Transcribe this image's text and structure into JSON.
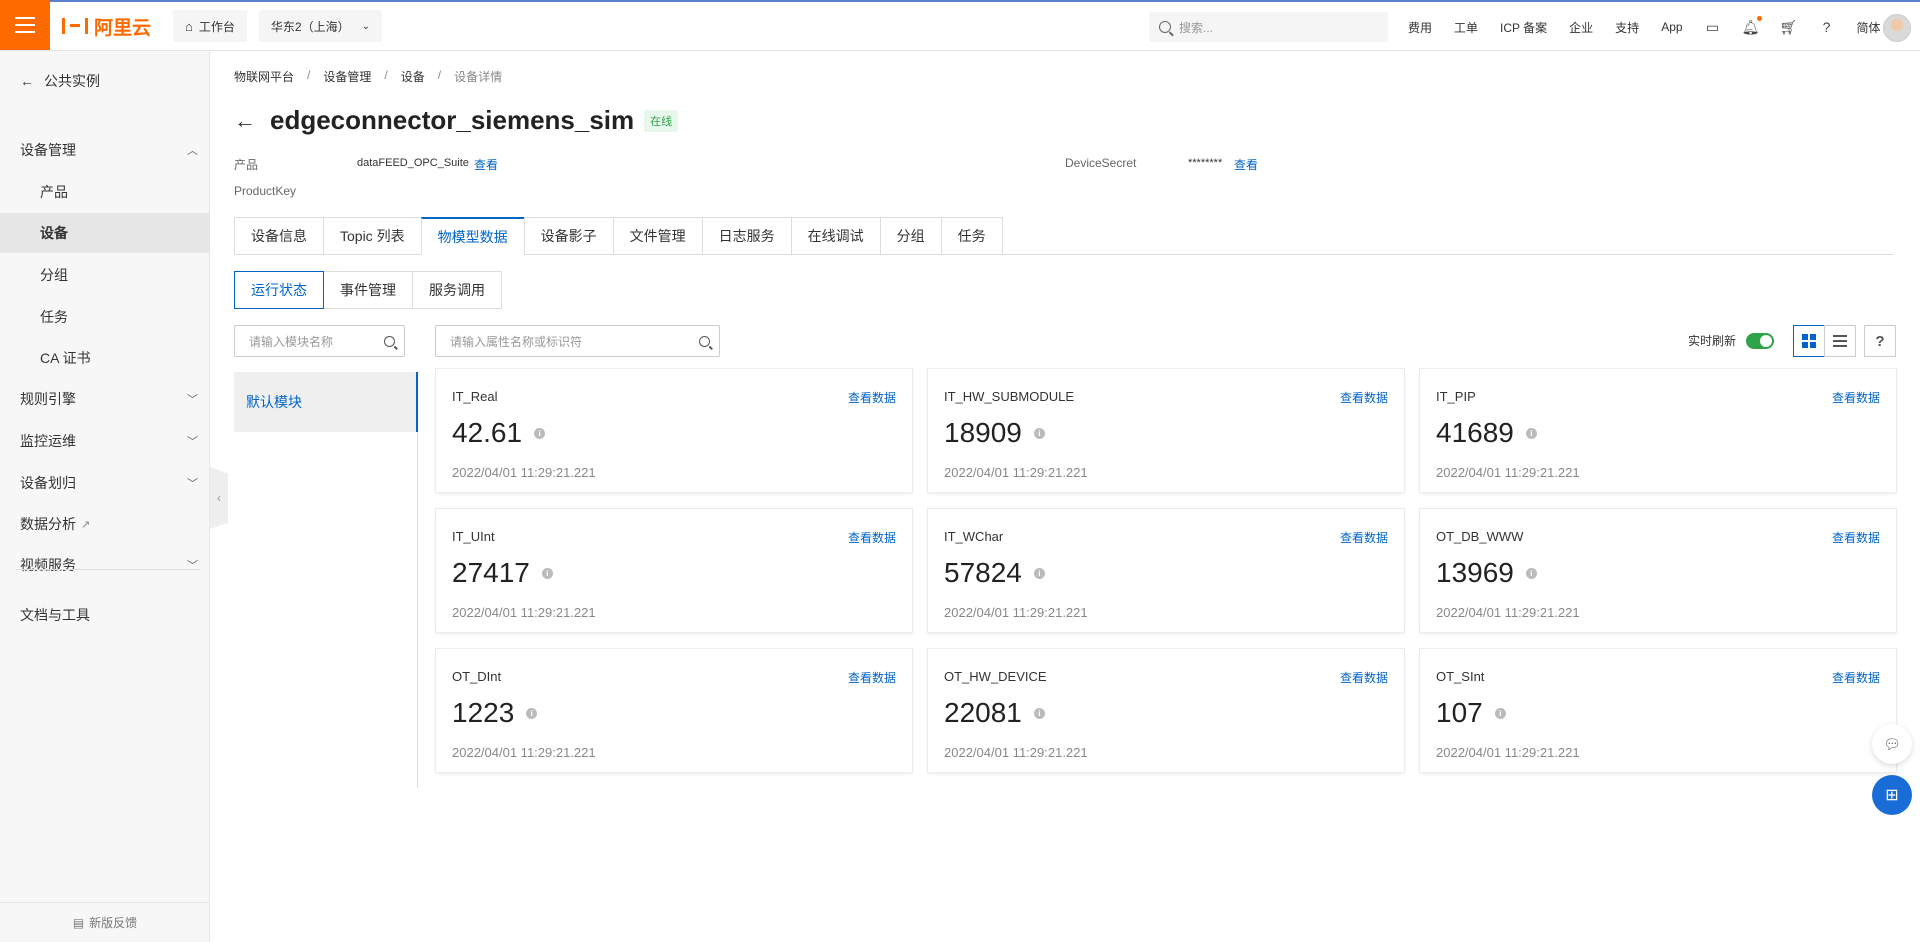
{
  "topbar": {
    "logo_text": "阿里云",
    "workbench": "工作台",
    "region": "华东2（上海）",
    "search_placeholder": "搜索...",
    "links": [
      "费用",
      "工单",
      "ICP 备案",
      "企业",
      "支持",
      "App"
    ],
    "lang": "简体",
    "accent": "#ff6a00"
  },
  "sidebar": {
    "back": "公共实例",
    "group_device": "设备管理",
    "items": [
      "产品",
      "设备",
      "分组",
      "任务",
      "CA 证书"
    ],
    "active_item": "设备",
    "groups": [
      "规则引擎",
      "监控运维",
      "设备划归",
      "数据分析",
      "视频服务"
    ],
    "docs": "文档与工具",
    "feedback": "新版反馈"
  },
  "breadcrumb": [
    "物联网平台",
    "设备管理",
    "设备",
    "设备详情"
  ],
  "device": {
    "name": "edgeconnector_siemens_sim",
    "status": "在线",
    "product_label": "产品",
    "product_value": "dataFEED_OPC_Suite",
    "view": "查看",
    "secret_label": "DeviceSecret",
    "secret_value": "********",
    "productkey_label": "ProductKey"
  },
  "tabs": [
    "设备信息",
    "Topic 列表",
    "物模型数据",
    "设备影子",
    "文件管理",
    "日志服务",
    "在线调试",
    "分组",
    "任务"
  ],
  "active_tab": "物模型数据",
  "subtabs": [
    "运行状态",
    "事件管理",
    "服务调用"
  ],
  "active_subtab": "运行状态",
  "module_search_placeholder": "请输入模块名称",
  "prop_search_placeholder": "请输入属性名称或标识符",
  "module": "默认模块",
  "refresh_label": "实时刷新",
  "card_view_label": "查看数据",
  "cards": [
    {
      "name": "IT_Real",
      "value": "42.61",
      "ts": "2022/04/01 11:29:21.221"
    },
    {
      "name": "IT_HW_SUBMODULE",
      "value": "18909",
      "ts": "2022/04/01 11:29:21.221"
    },
    {
      "name": "IT_PIP",
      "value": "41689",
      "ts": "2022/04/01 11:29:21.221"
    },
    {
      "name": "IT_UInt",
      "value": "27417",
      "ts": "2022/04/01 11:29:21.221"
    },
    {
      "name": "IT_WChar",
      "value": "57824",
      "ts": "2022/04/01 11:29:21.221"
    },
    {
      "name": "OT_DB_WWW",
      "value": "13969",
      "ts": "2022/04/01 11:29:21.221"
    },
    {
      "name": "OT_DInt",
      "value": "1223",
      "ts": "2022/04/01 11:29:21.221"
    },
    {
      "name": "OT_HW_DEVICE",
      "value": "22081",
      "ts": "2022/04/01 11:29:21.221"
    },
    {
      "name": "OT_SInt",
      "value": "107",
      "ts": "2022/04/01 11:29:21.221"
    }
  ]
}
